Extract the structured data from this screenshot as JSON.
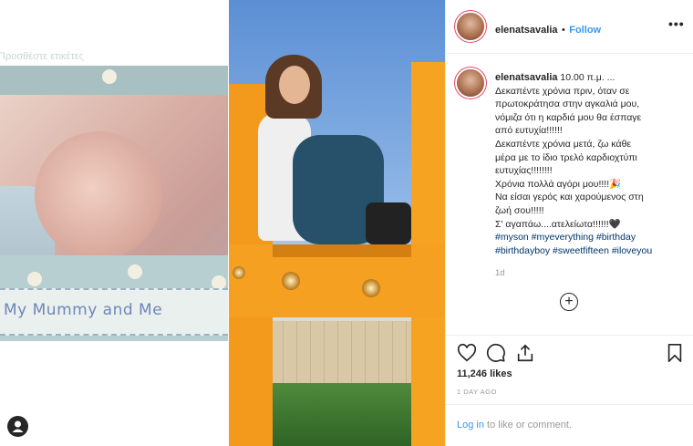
{
  "left_panel": {
    "tag_hint": "Προσθέστε ετικέτες",
    "ribbon_text": "My Mummy and Me"
  },
  "post": {
    "header": {
      "username": "elenatsavalia",
      "separator": "•",
      "follow_label": "Follow",
      "more_label": "•••"
    },
    "caption": {
      "username": "elenatsavalia",
      "time": "10.00 π.μ. ...",
      "lines": [
        "Δεκαπέντε χρόνια πριν, όταν σε",
        "πρωτοκράτησα στην αγκαλιά μου,",
        "νόμιζα ότι η καρδιά μου θα έσπαγε",
        "από ευτυχία!!!!!!",
        "Δεκαπέντε χρόνια μετά, ζω κάθε",
        "μέρα με το ίδιο τρελό καρδιοχτύπι",
        "ευτυχίας!!!!!!!!",
        "Χρόνια πολλά αγόρι μου!!!!🎉",
        "Να είσαι γερός και χαρούμενος στη",
        "ζωή σου!!!!!",
        "Σ' αγαπάω....ατελείωτα!!!!!!🖤"
      ],
      "hashtags_line1": "#myson #myeverything #birthday",
      "hashtags_line2": "#birthdayboy #sweetfifteen #iloveyou"
    },
    "time_ago": "1d",
    "add_comment_icon": "+",
    "likes": "11,246 likes",
    "posted_date": "1 DAY AGO",
    "login_link": "Log in",
    "login_rest": " to like or comment."
  },
  "icons": [
    "heart-icon",
    "comment-icon",
    "share-icon",
    "bookmark-icon",
    "more-icon",
    "add-comment-icon",
    "user-tags-icon"
  ],
  "colors": {
    "accent": "#3897f0",
    "text": "#262626",
    "muted": "#999999",
    "hashtag": "#003569"
  }
}
